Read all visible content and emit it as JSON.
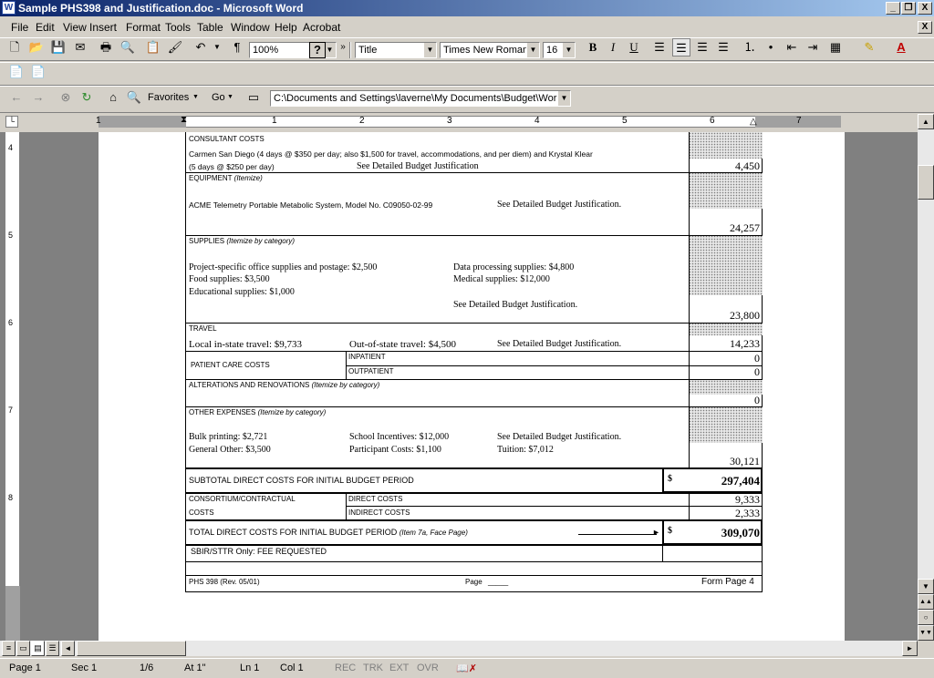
{
  "window": {
    "title": "Sample PHS398 and Justification.doc - Microsoft Word",
    "app_icon": "W",
    "minimize": "_",
    "restore": "❐",
    "close": "X",
    "doc_close": "X"
  },
  "menu": [
    "File",
    "Edit",
    "View",
    "Insert",
    "Format",
    "Tools",
    "Table",
    "Window",
    "Help",
    "Acrobat"
  ],
  "toolbar": {
    "zoom": "100%",
    "style": "Title",
    "font": "Times New Roman",
    "size": "16",
    "bold": "B",
    "italic": "I",
    "underline": "U"
  },
  "web_toolbar": {
    "favorites": "Favorites",
    "go": "Go",
    "address": "C:\\Documents and Settings\\laverne\\My Documents\\Budget\\Work:"
  },
  "ruler": {
    "numbers": [
      "1",
      "1",
      "2",
      "3",
      "4",
      "5",
      "6",
      "7"
    ],
    "vertical": [
      "4",
      "5",
      "6",
      "7",
      "8"
    ]
  },
  "form": {
    "consultant": {
      "heading": "CONSULTANT COSTS",
      "line1": "Carmen San Diego (4 days @ $350 per day; also $1,500 for travel, accommodations, and per diem) and Krystal Klear",
      "line2": "(5 days @ $250 per day)",
      "justification": "See Detailed Budget Justification",
      "amount": "4,450"
    },
    "equipment": {
      "heading": "EQUIPMENT",
      "note": "(Itemize)",
      "item": "ACME Telemetry Portable Metabolic System, Model No. C09050-02-99",
      "justification": "See Detailed Budget Justification.",
      "amount": "24,257"
    },
    "supplies": {
      "heading": "SUPPLIES",
      "note": "(Itemize by category)",
      "office": "Project-specific office supplies and postage: $2,500",
      "data": "Data processing supplies: $4,800",
      "food": "Food supplies: $3,500",
      "medical": "Medical supplies: $12,000",
      "education": "Educational supplies: $1,000",
      "justification": "See Detailed Budget Justification.",
      "amount": "23,800"
    },
    "travel": {
      "heading": "TRAVEL",
      "local": "Local in-state travel:  $9,733",
      "out": "Out-of-state travel:  $4,500",
      "justification": "See Detailed Budget Justification.",
      "amount": "14,233"
    },
    "patient": {
      "heading": "PATIENT CARE COSTS",
      "inpatient": "INPATIENT",
      "outpatient": "OUTPATIENT",
      "in_amount": "0",
      "out_amount": "0"
    },
    "alterations": {
      "heading": "ALTERATIONS AND RENOVATIONS",
      "note": "(Itemize by category)",
      "amount": "0"
    },
    "other": {
      "heading": "OTHER EXPENSES",
      "note": "(Itemize by category)",
      "bulk": "Bulk printing: $2,721",
      "school": "School Incentives: $12,000",
      "justification": "See Detailed Budget Justification.",
      "general": "General Other: $3,500",
      "participant": "Participant Costs: $1,100",
      "tuition": "Tuition: $7,012",
      "amount": "30,121"
    },
    "subtotal": {
      "label": "SUBTOTAL DIRECT COSTS FOR INITIAL BUDGET PERIOD",
      "dollar": "$",
      "amount": "297,404"
    },
    "consortium": {
      "label1": "CONSORTIUM/CONTRACTUAL",
      "label2": "COSTS",
      "direct": "DIRECT COSTS",
      "indirect": "INDIRECT COSTS",
      "direct_amount": "9,333",
      "indirect_amount": "2,333"
    },
    "total": {
      "label": "TOTAL DIRECT COSTS FOR INITIAL BUDGET PERIOD",
      "note": "(Item 7a, Face Page)",
      "dollar": "$",
      "amount": "309,070"
    },
    "sbir": {
      "label": "SBIR/STTR Only: FEE REQUESTED"
    },
    "footer": {
      "form_id": "PHS 398 (Rev. 05/01)",
      "page": "Page",
      "page_blank": "_____",
      "form_page": "Form Page 4"
    }
  },
  "status": {
    "page": "Page  1",
    "sec": "Sec  1",
    "pages": "1/6",
    "at": "At  1\"",
    "ln": "Ln  1",
    "col": "Col  1",
    "rec": "REC",
    "trk": "TRK",
    "ext": "EXT",
    "ovr": "OVR"
  }
}
